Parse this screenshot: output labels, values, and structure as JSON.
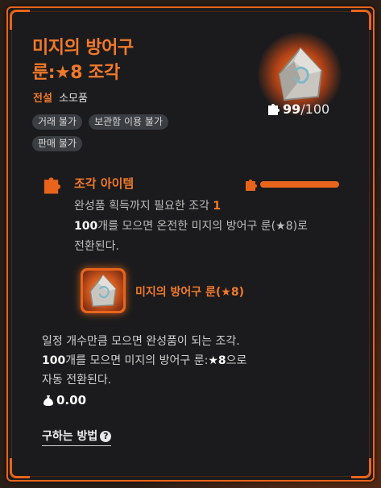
{
  "item": {
    "title_line1": "미지의 방어구",
    "title_line2": "룬:★8 조각",
    "grade": "전설",
    "category": "소모품",
    "tags": [
      "거래 불가",
      "보관함 이용 불가",
      "판매 불가"
    ],
    "count_current": "99",
    "count_total": "/100"
  },
  "piece_section": {
    "title": "조각 아이템",
    "desc_part1": "완성품 획득까지 필요한 조각 ",
    "desc_needed": "1",
    "desc_part2": "100",
    "desc_part3": "개를 모으면 온전한 미지의 방어구 룬(★8)로 전환된다.",
    "result_name": "미지의 방어구 룬(★8)"
  },
  "description": {
    "line1": "일정 개수만큼 모으면 완성품이 되는 조각.",
    "line2_bold": "100",
    "line2_rest": "개를 모으면 미지의 방어구 룬:",
    "line2_bold2": "★8",
    "line2_end": "으로",
    "line3": "자동 전환된다."
  },
  "price": "0.00",
  "howto_label": "구하는 방법",
  "howto_icon": "?",
  "colors": {
    "accent": "#e8641c",
    "panel": "#1b1b1d"
  }
}
